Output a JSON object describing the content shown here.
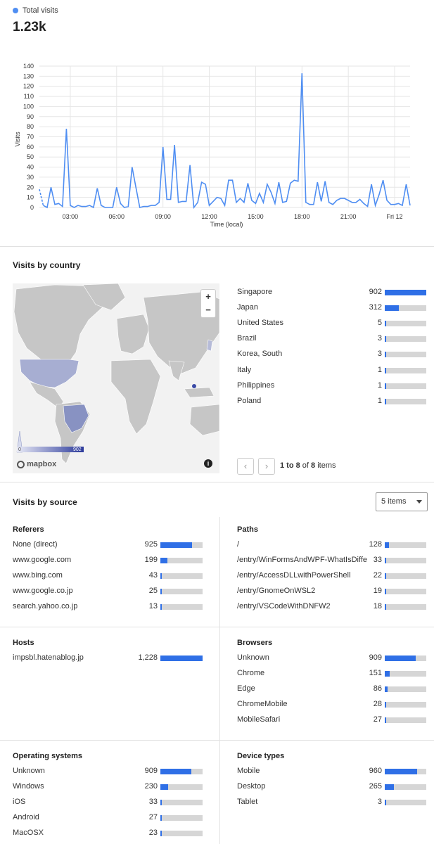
{
  "summary": {
    "legend_label": "Total visits",
    "total": "1.23k",
    "color": "#4f8ef2"
  },
  "chart_data": {
    "type": "line",
    "ylabel": "Visits",
    "xlabel": "Time (local)",
    "ylim": [
      0,
      140
    ],
    "yticks": [
      0,
      10,
      20,
      30,
      40,
      50,
      60,
      70,
      80,
      90,
      100,
      110,
      120,
      130,
      140
    ],
    "xticks": [
      {
        "label": "03:00",
        "t": 3
      },
      {
        "label": "06:00",
        "t": 6
      },
      {
        "label": "09:00",
        "t": 9
      },
      {
        "label": "12:00",
        "t": 12
      },
      {
        "label": "15:00",
        "t": 15
      },
      {
        "label": "18:00",
        "t": 18
      },
      {
        "label": "21:00",
        "t": 21
      },
      {
        "label": "Fri 12",
        "t": 24
      }
    ],
    "x_range": [
      1,
      25
    ],
    "dashed_head": [
      [
        1.0,
        18
      ],
      [
        1.25,
        2
      ]
    ],
    "series": [
      {
        "values": [
          [
            1.25,
            2
          ],
          [
            1.5,
            0
          ],
          [
            1.75,
            20
          ],
          [
            2.0,
            3
          ],
          [
            2.25,
            4
          ],
          [
            2.5,
            1
          ],
          [
            2.75,
            78
          ],
          [
            3.0,
            2
          ],
          [
            3.25,
            0
          ],
          [
            3.5,
            2
          ],
          [
            3.75,
            1
          ],
          [
            4.0,
            1
          ],
          [
            4.25,
            2
          ],
          [
            4.5,
            0
          ],
          [
            4.75,
            19
          ],
          [
            5.0,
            2
          ],
          [
            5.25,
            0
          ],
          [
            5.5,
            0
          ],
          [
            5.75,
            0
          ],
          [
            6.0,
            20
          ],
          [
            6.25,
            4
          ],
          [
            6.5,
            0
          ],
          [
            6.75,
            1
          ],
          [
            7.0,
            40
          ],
          [
            7.25,
            20
          ],
          [
            7.5,
            0
          ],
          [
            7.75,
            1
          ],
          [
            8.0,
            1
          ],
          [
            8.25,
            2
          ],
          [
            8.5,
            2
          ],
          [
            8.75,
            5
          ],
          [
            9.0,
            60
          ],
          [
            9.25,
            8
          ],
          [
            9.5,
            8
          ],
          [
            9.75,
            62
          ],
          [
            10.0,
            5
          ],
          [
            10.25,
            6
          ],
          [
            10.5,
            6
          ],
          [
            10.75,
            42
          ],
          [
            11.0,
            0
          ],
          [
            11.25,
            5
          ],
          [
            11.5,
            25
          ],
          [
            11.75,
            23
          ],
          [
            12.0,
            2
          ],
          [
            12.25,
            6
          ],
          [
            12.5,
            10
          ],
          [
            12.75,
            9
          ],
          [
            13.0,
            2
          ],
          [
            13.25,
            27
          ],
          [
            13.5,
            27
          ],
          [
            13.75,
            5
          ],
          [
            14.0,
            9
          ],
          [
            14.25,
            5
          ],
          [
            14.5,
            24
          ],
          [
            14.75,
            7
          ],
          [
            15.0,
            4
          ],
          [
            15.25,
            14
          ],
          [
            15.5,
            5
          ],
          [
            15.75,
            23
          ],
          [
            16.0,
            15
          ],
          [
            16.25,
            4
          ],
          [
            16.5,
            25
          ],
          [
            16.75,
            5
          ],
          [
            17.0,
            6
          ],
          [
            17.25,
            24
          ],
          [
            17.5,
            27
          ],
          [
            17.75,
            26
          ],
          [
            18.0,
            133
          ],
          [
            18.25,
            5
          ],
          [
            18.5,
            3
          ],
          [
            18.75,
            3
          ],
          [
            19.0,
            25
          ],
          [
            19.25,
            6
          ],
          [
            19.5,
            26
          ],
          [
            19.75,
            5
          ],
          [
            20.0,
            3
          ],
          [
            20.25,
            7
          ],
          [
            20.5,
            9
          ],
          [
            20.75,
            9
          ],
          [
            21.0,
            7
          ],
          [
            21.25,
            5
          ],
          [
            21.5,
            5
          ],
          [
            21.75,
            8
          ],
          [
            22.0,
            4
          ],
          [
            22.25,
            1
          ],
          [
            22.5,
            23
          ],
          [
            22.75,
            2
          ],
          [
            23.0,
            13
          ],
          [
            23.25,
            27
          ],
          [
            23.5,
            7
          ],
          [
            23.75,
            3
          ],
          [
            24.0,
            3
          ],
          [
            24.25,
            4
          ],
          [
            24.5,
            2
          ],
          [
            24.75,
            23
          ],
          [
            25.0,
            2
          ]
        ]
      }
    ],
    "grid": true
  },
  "country": {
    "title": "Visits by country",
    "zoom_in": "+",
    "zoom_out": "−",
    "scale_min": "0",
    "scale_max": "902",
    "mapbox_label": "mapbox",
    "info_icon": "info-icon",
    "items": [
      {
        "name": "Singapore",
        "value": "902",
        "frac": 1.0
      },
      {
        "name": "Japan",
        "value": "312",
        "frac": 0.346
      },
      {
        "name": "United States",
        "value": "5",
        "frac": 0.006
      },
      {
        "name": "Brazil",
        "value": "3",
        "frac": 0.004
      },
      {
        "name": "Korea, South",
        "value": "3",
        "frac": 0.004
      },
      {
        "name": "Italy",
        "value": "1",
        "frac": 0.002
      },
      {
        "name": "Philippines",
        "value": "1",
        "frac": 0.002
      },
      {
        "name": "Poland",
        "value": "1",
        "frac": 0.002
      }
    ],
    "pager": {
      "prev": "‹",
      "next": "›",
      "range": "1 to 8",
      "of": "of",
      "total": "8",
      "suffix": "items"
    }
  },
  "source": {
    "title": "Visits by source",
    "dropdown_value": "5 items",
    "referers": {
      "title": "Referers",
      "items": [
        {
          "name": "None (direct)",
          "value": "925",
          "frac": 0.75
        },
        {
          "name": "www.google.com",
          "value": "199",
          "frac": 0.162
        },
        {
          "name": "www.bing.com",
          "value": "43",
          "frac": 0.035
        },
        {
          "name": "www.google.co.jp",
          "value": "25",
          "frac": 0.02
        },
        {
          "name": "search.yahoo.co.jp",
          "value": "13",
          "frac": 0.011
        }
      ]
    },
    "paths": {
      "title": "Paths",
      "items": [
        {
          "name": "/",
          "value": "128",
          "frac": 0.104
        },
        {
          "name": "/entry/WinFormsAndWPF-WhatIsDiffe...",
          "value": "33",
          "frac": 0.027
        },
        {
          "name": "/entry/AccessDLLwithPowerShell",
          "value": "22",
          "frac": 0.018
        },
        {
          "name": "/entry/GnomeOnWSL2",
          "value": "19",
          "frac": 0.015
        },
        {
          "name": "/entry/VSCodeWithDNFW2",
          "value": "18",
          "frac": 0.015
        }
      ]
    },
    "hosts": {
      "title": "Hosts",
      "items": [
        {
          "name": "impsbl.hatenablog.jp",
          "value": "1,228",
          "frac": 1.0
        }
      ]
    },
    "browsers": {
      "title": "Browsers",
      "items": [
        {
          "name": "Unknown",
          "value": "909",
          "frac": 0.74
        },
        {
          "name": "Chrome",
          "value": "151",
          "frac": 0.123
        },
        {
          "name": "Edge",
          "value": "86",
          "frac": 0.07
        },
        {
          "name": "ChromeMobile",
          "value": "28",
          "frac": 0.023
        },
        {
          "name": "MobileSafari",
          "value": "27",
          "frac": 0.022
        }
      ]
    },
    "os": {
      "title": "Operating systems",
      "items": [
        {
          "name": "Unknown",
          "value": "909",
          "frac": 0.74
        },
        {
          "name": "Windows",
          "value": "230",
          "frac": 0.187
        },
        {
          "name": "iOS",
          "value": "33",
          "frac": 0.027
        },
        {
          "name": "Android",
          "value": "27",
          "frac": 0.022
        },
        {
          "name": "MacOSX",
          "value": "23",
          "frac": 0.019
        }
      ]
    },
    "devices": {
      "title": "Device types",
      "items": [
        {
          "name": "Mobile",
          "value": "960",
          "frac": 0.782
        },
        {
          "name": "Desktop",
          "value": "265",
          "frac": 0.216
        },
        {
          "name": "Tablet",
          "value": "3",
          "frac": 0.003
        }
      ]
    }
  }
}
